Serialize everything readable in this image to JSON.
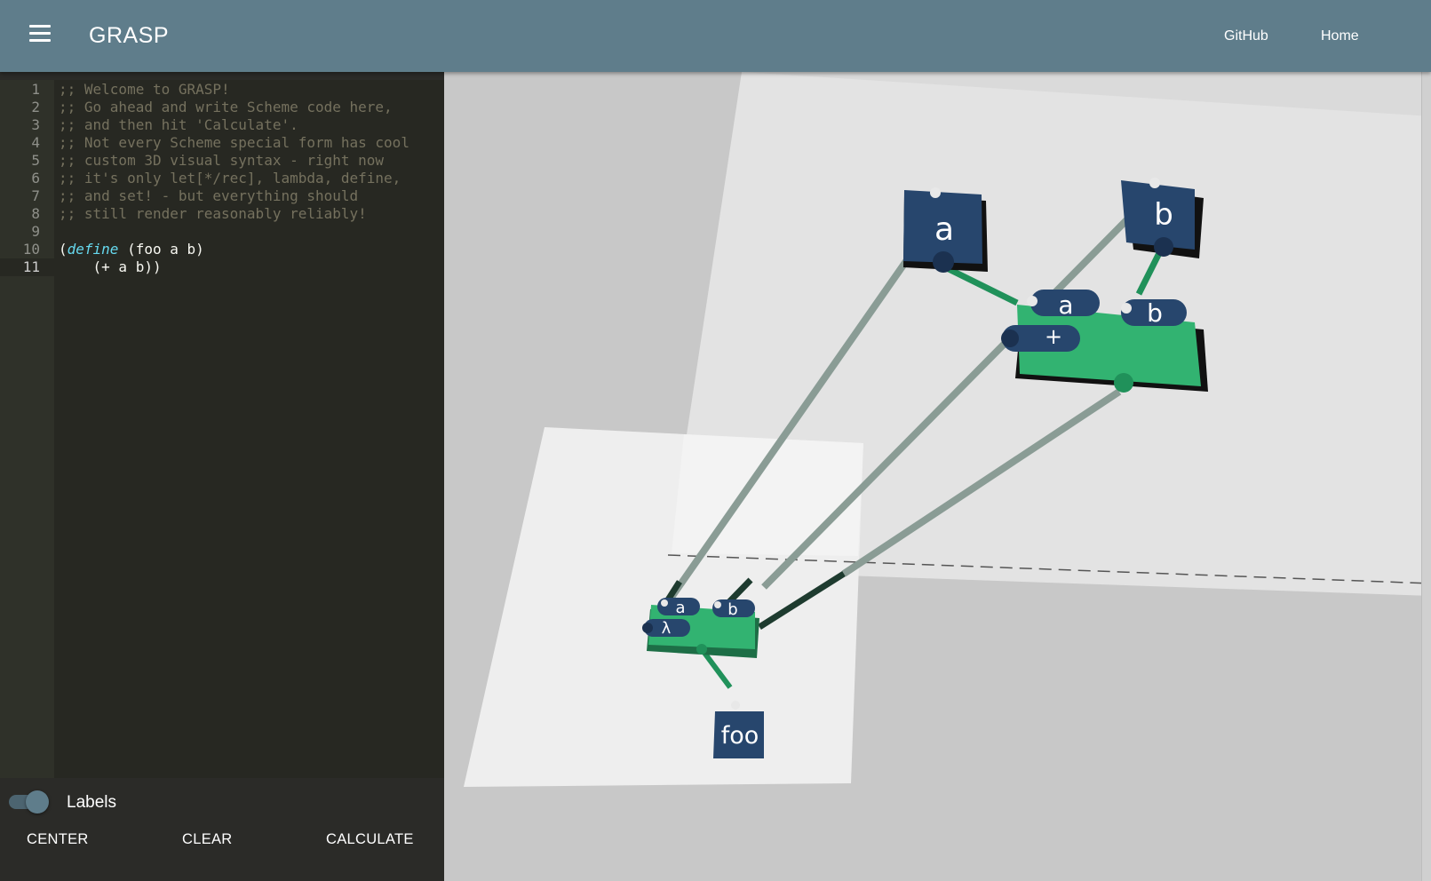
{
  "header": {
    "title": "GRASP",
    "links": {
      "github": "GitHub",
      "home": "Home"
    }
  },
  "editor": {
    "lines": [
      {
        "n": "1",
        "text": ";; Welcome to GRASP!"
      },
      {
        "n": "2",
        "text": ";; Go ahead and write Scheme code here,"
      },
      {
        "n": "3",
        "text": ";; and then hit 'Calculate'."
      },
      {
        "n": "4",
        "text": ";; Not every Scheme special form has cool"
      },
      {
        "n": "5",
        "text": ";; custom 3D visual syntax - right now"
      },
      {
        "n": "6",
        "text": ";; it's only let[*/rec], lambda, define,"
      },
      {
        "n": "7",
        "text": ";; and set! - but everything should"
      },
      {
        "n": "8",
        "text": ";; still render reasonably reliably!"
      },
      {
        "n": "9",
        "text": ""
      },
      {
        "n": "10",
        "open": "(",
        "keyword": "define",
        "rest": " (foo a b)"
      },
      {
        "n": "11",
        "text": "    (+ a b))"
      }
    ]
  },
  "controls": {
    "labels_toggle": {
      "label": "Labels",
      "on": true
    },
    "buttons": {
      "center": "CENTER",
      "clear": "CLEAR",
      "calculate": "CALCULATE"
    }
  },
  "scene": {
    "nodes": {
      "param_a": "a",
      "param_b": "b",
      "plus_arg_a": "a",
      "plus_arg_b": "b",
      "plus_op": "+",
      "lambda_arg_a": "a",
      "lambda_arg_b": "b",
      "lambda_op": "λ",
      "define_name": "foo"
    },
    "colors": {
      "node_blue": "#27466d",
      "node_green": "#32b371",
      "wire": "#8a9c95",
      "wire_dark": "#1e3b2f",
      "plane_light": "#e6e6e6",
      "background": "#c8c8c8"
    }
  }
}
